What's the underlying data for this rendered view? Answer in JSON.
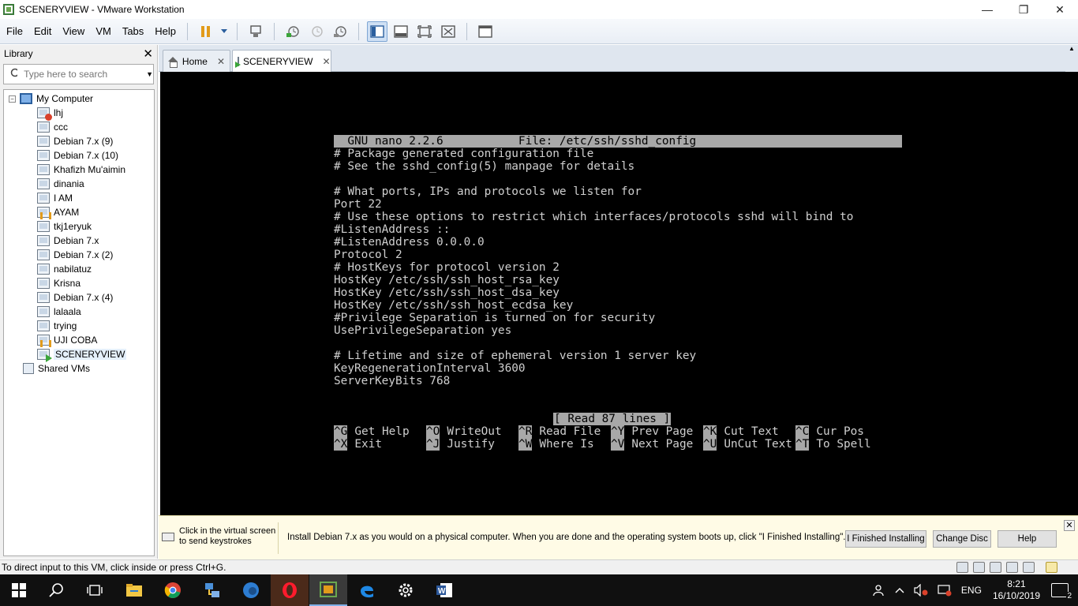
{
  "window": {
    "title": "SCENERYVIEW - VMware Workstation",
    "controls": {
      "minimize": "—",
      "maximize": "❐",
      "close": "✕"
    }
  },
  "menu": [
    "File",
    "Edit",
    "View",
    "VM",
    "Tabs",
    "Help"
  ],
  "toolbar_icons": [
    "pause-icon",
    "dropdown-icon",
    "send-ctrl-alt-del-icon",
    "snapshot-icon",
    "revert-snapshot-icon",
    "snapshot-manager-icon",
    "show-library-icon",
    "thumbnail-bar-icon",
    "full-screen-icon",
    "unity-icon",
    "console-view-icon"
  ],
  "library": {
    "title": "Library",
    "close": "✕",
    "search_placeholder": "Type here to search",
    "root": "My Computer",
    "items": [
      {
        "label": "lhj",
        "state": "error"
      },
      {
        "label": "ccc",
        "state": "off"
      },
      {
        "label": "Debian 7.x (9)",
        "state": "off"
      },
      {
        "label": "Debian 7.x (10)",
        "state": "off"
      },
      {
        "label": "Khafizh Mu'aimin",
        "state": "off"
      },
      {
        "label": "dinania",
        "state": "off"
      },
      {
        "label": "I AM",
        "state": "off"
      },
      {
        "label": "AYAM",
        "state": "paused"
      },
      {
        "label": "tkj1eryuk",
        "state": "off"
      },
      {
        "label": "Debian 7.x",
        "state": "off"
      },
      {
        "label": "Debian 7.x (2)",
        "state": "off"
      },
      {
        "label": "nabilatuz",
        "state": "off"
      },
      {
        "label": "Krisna",
        "state": "off"
      },
      {
        "label": "Debian 7.x (4)",
        "state": "off"
      },
      {
        "label": "lalaala",
        "state": "off"
      },
      {
        "label": "trying",
        "state": "off"
      },
      {
        "label": "UJI COBA",
        "state": "paused"
      },
      {
        "label": "SCENERYVIEW",
        "state": "running"
      }
    ],
    "shared": "Shared VMs"
  },
  "tabs": [
    {
      "label": "Home",
      "close": "✕"
    },
    {
      "label": "SCENERYVIEW",
      "close": "✕"
    }
  ],
  "terminal": {
    "header": "  GNU nano 2.2.6           File: /etc/ssh/sshd_config",
    "lines": [
      "",
      "# Package generated configuration file",
      "# See the sshd_config(5) manpage for details",
      "",
      "# What ports, IPs and protocols we listen for",
      "Port 22",
      "# Use these options to restrict which interfaces/protocols sshd will bind to",
      "#ListenAddress ::",
      "#ListenAddress 0.0.0.0",
      "Protocol 2",
      "# HostKeys for protocol version 2",
      "HostKey /etc/ssh/ssh_host_rsa_key",
      "HostKey /etc/ssh/ssh_host_dsa_key",
      "HostKey /etc/ssh/ssh_host_ecdsa_key",
      "#Privilege Separation is turned on for security",
      "UsePrivilegeSeparation yes",
      "",
      "# Lifetime and size of ephemeral version 1 server key",
      "KeyRegenerationInterval 3600",
      "ServerKeyBits 768"
    ],
    "status": "[ Read 87 lines ]",
    "shortcuts_row1": [
      {
        "key": "^G",
        "desc": "Get Help"
      },
      {
        "key": "^O",
        "desc": "WriteOut"
      },
      {
        "key": "^R",
        "desc": "Read File"
      },
      {
        "key": "^Y",
        "desc": "Prev Page"
      },
      {
        "key": "^K",
        "desc": "Cut Text"
      },
      {
        "key": "^C",
        "desc": "Cur Pos"
      }
    ],
    "shortcuts_row2": [
      {
        "key": "^X",
        "desc": "Exit"
      },
      {
        "key": "^J",
        "desc": "Justify"
      },
      {
        "key": "^W",
        "desc": "Where Is"
      },
      {
        "key": "^V",
        "desc": "Next Page"
      },
      {
        "key": "^U",
        "desc": "UnCut Text"
      },
      {
        "key": "^T",
        "desc": "To Spell"
      }
    ]
  },
  "hintbar": {
    "click_hint": "Click in the virtual screen to send keystrokes",
    "message": "Install Debian 7.x as you would on a physical computer. When you are done and the operating system boots up, click \"I Finished Installing\".",
    "btn_finished": "I Finished Installing",
    "btn_change_disc": "Change Disc",
    "btn_help": "Help",
    "close": "✕"
  },
  "statusbar": {
    "text": "To direct input to this VM, click inside or press Ctrl+G."
  },
  "taskbar": {
    "apps": [
      "start-icon",
      "search-icon",
      "task-view-icon",
      "file-explorer-icon",
      "chrome-icon",
      "network-app-icon",
      "edge-chromium-icon",
      "opera-icon",
      "vmware-icon",
      "edge-icon",
      "settings-icon",
      "word-icon"
    ],
    "language": "ENG",
    "time": "8:21",
    "date": "16/10/2019",
    "notifications": "2"
  }
}
